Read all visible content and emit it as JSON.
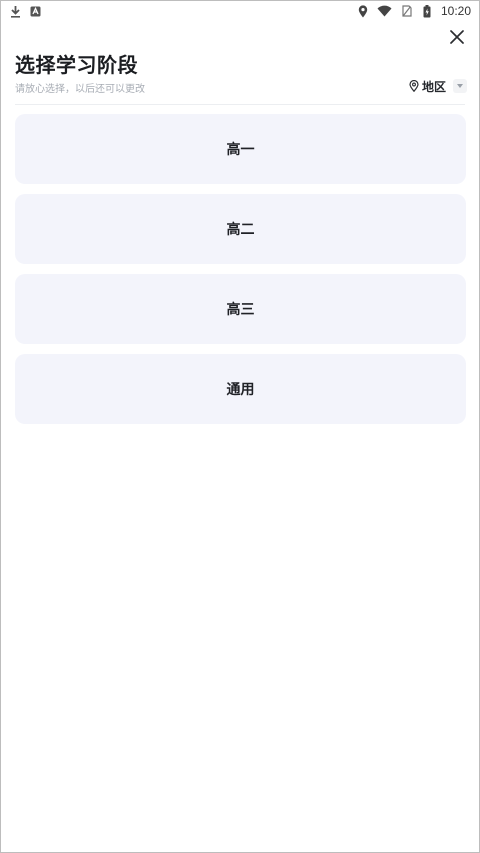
{
  "status_bar": {
    "time": "10:20",
    "left_icons": [
      "download-icon",
      "keyboard-icon"
    ],
    "right_icons": [
      "location-icon",
      "wifi-icon",
      "sim-icon",
      "battery-icon"
    ]
  },
  "header": {
    "title": "选择学习阶段",
    "subtitle": "请放心选择，以后还可以更改",
    "region_label": "地区",
    "region_icon": "location-pin-icon"
  },
  "options": [
    {
      "label": "高一"
    },
    {
      "label": "高二"
    },
    {
      "label": "高三"
    },
    {
      "label": "通用"
    }
  ],
  "colors": {
    "option_bg": "#f3f4fb",
    "title": "#1b1d21",
    "subtitle": "#a7acb4"
  }
}
